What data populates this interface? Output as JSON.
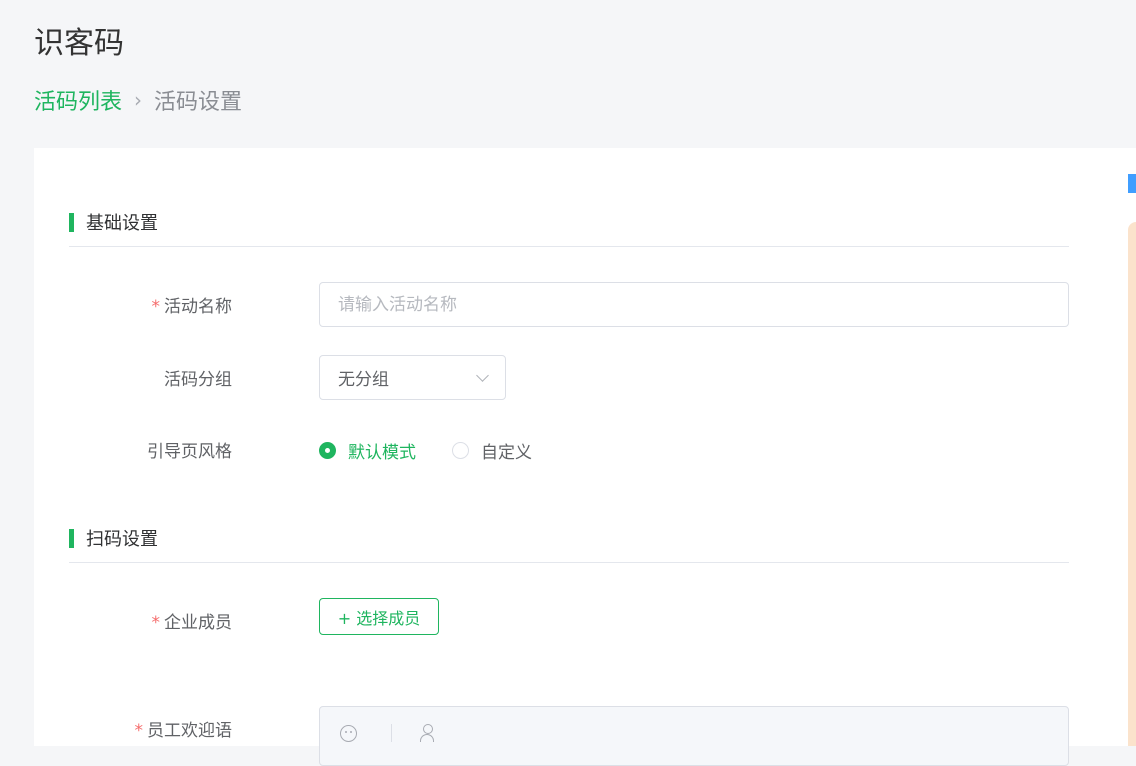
{
  "header": {
    "title": "识客码"
  },
  "breadcrumb": {
    "parent": "活码列表",
    "current": "活码设置"
  },
  "sections": {
    "basic": {
      "title": "基础设置",
      "activity_name": {
        "label": "活动名称",
        "required": true,
        "placeholder": "请输入活动名称",
        "value": ""
      },
      "activity_group": {
        "label": "活码分组",
        "selected": "无分组"
      },
      "guide_style": {
        "label": "引导页风格",
        "options": [
          "默认模式",
          "自定义"
        ],
        "selected": "默认模式"
      }
    },
    "scan": {
      "title": "扫码设置",
      "members": {
        "label": "企业成员",
        "required": true,
        "button_label": "+ 选择成员"
      },
      "welcome": {
        "label": "员工欢迎语",
        "required": true
      }
    }
  },
  "icons": {
    "breadcrumb_separator": "chevron-right-icon",
    "select_arrow": "chevron-down-icon",
    "editor_emoji": "emoji-icon",
    "editor_user": "user-icon"
  },
  "colors": {
    "accent": "#1fb55f",
    "required": "#f56c6c",
    "page_bg": "#f5f6f8"
  }
}
